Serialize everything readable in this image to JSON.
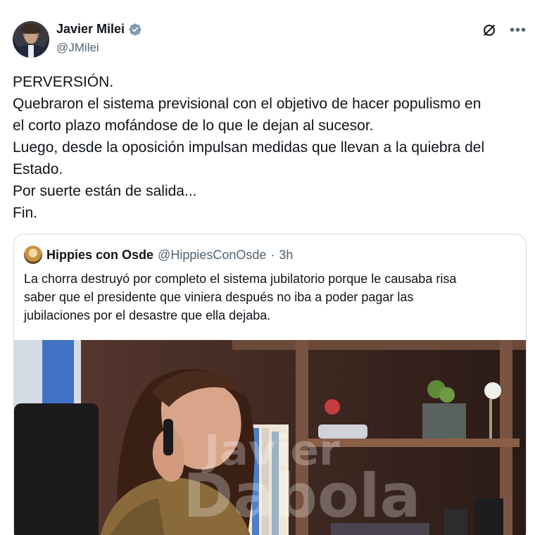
{
  "tweet": {
    "author": {
      "name": "Javier Milei",
      "handle": "@JMilei"
    },
    "lines": [
      "PERVERSIÓN.",
      "Quebraron el sistema previsional con el objetivo de hacer populismo en",
      "el corto plazo mofándose de lo que le dejan al sucesor.",
      "Luego, desde la oposición impulsan medidas que llevan a la quiebra del",
      "Estado.",
      "Por suerte están de salida...",
      "Fin."
    ]
  },
  "quote": {
    "name": "Hippies con Osde",
    "handle": "@HippiesConOsde",
    "separator": "·",
    "time": "3h",
    "lines": [
      "La chorra destruyó por completo el sistema jubilatorio porque le causaba risa",
      "saber que el presidente que viniera después no iba a poder pagar las",
      "jubilaciones por el desastre que ella dejaba."
    ],
    "watermark": {
      "line1": "Javier",
      "line2": "Dabola"
    }
  },
  "icons": {
    "verified": "verified-badge-icon",
    "grok": "grok-icon",
    "more": "more-options-icon"
  },
  "colors": {
    "text": "#0f1419",
    "secondary": "#536471",
    "border": "#cfd9de",
    "verified": "#829aab"
  }
}
